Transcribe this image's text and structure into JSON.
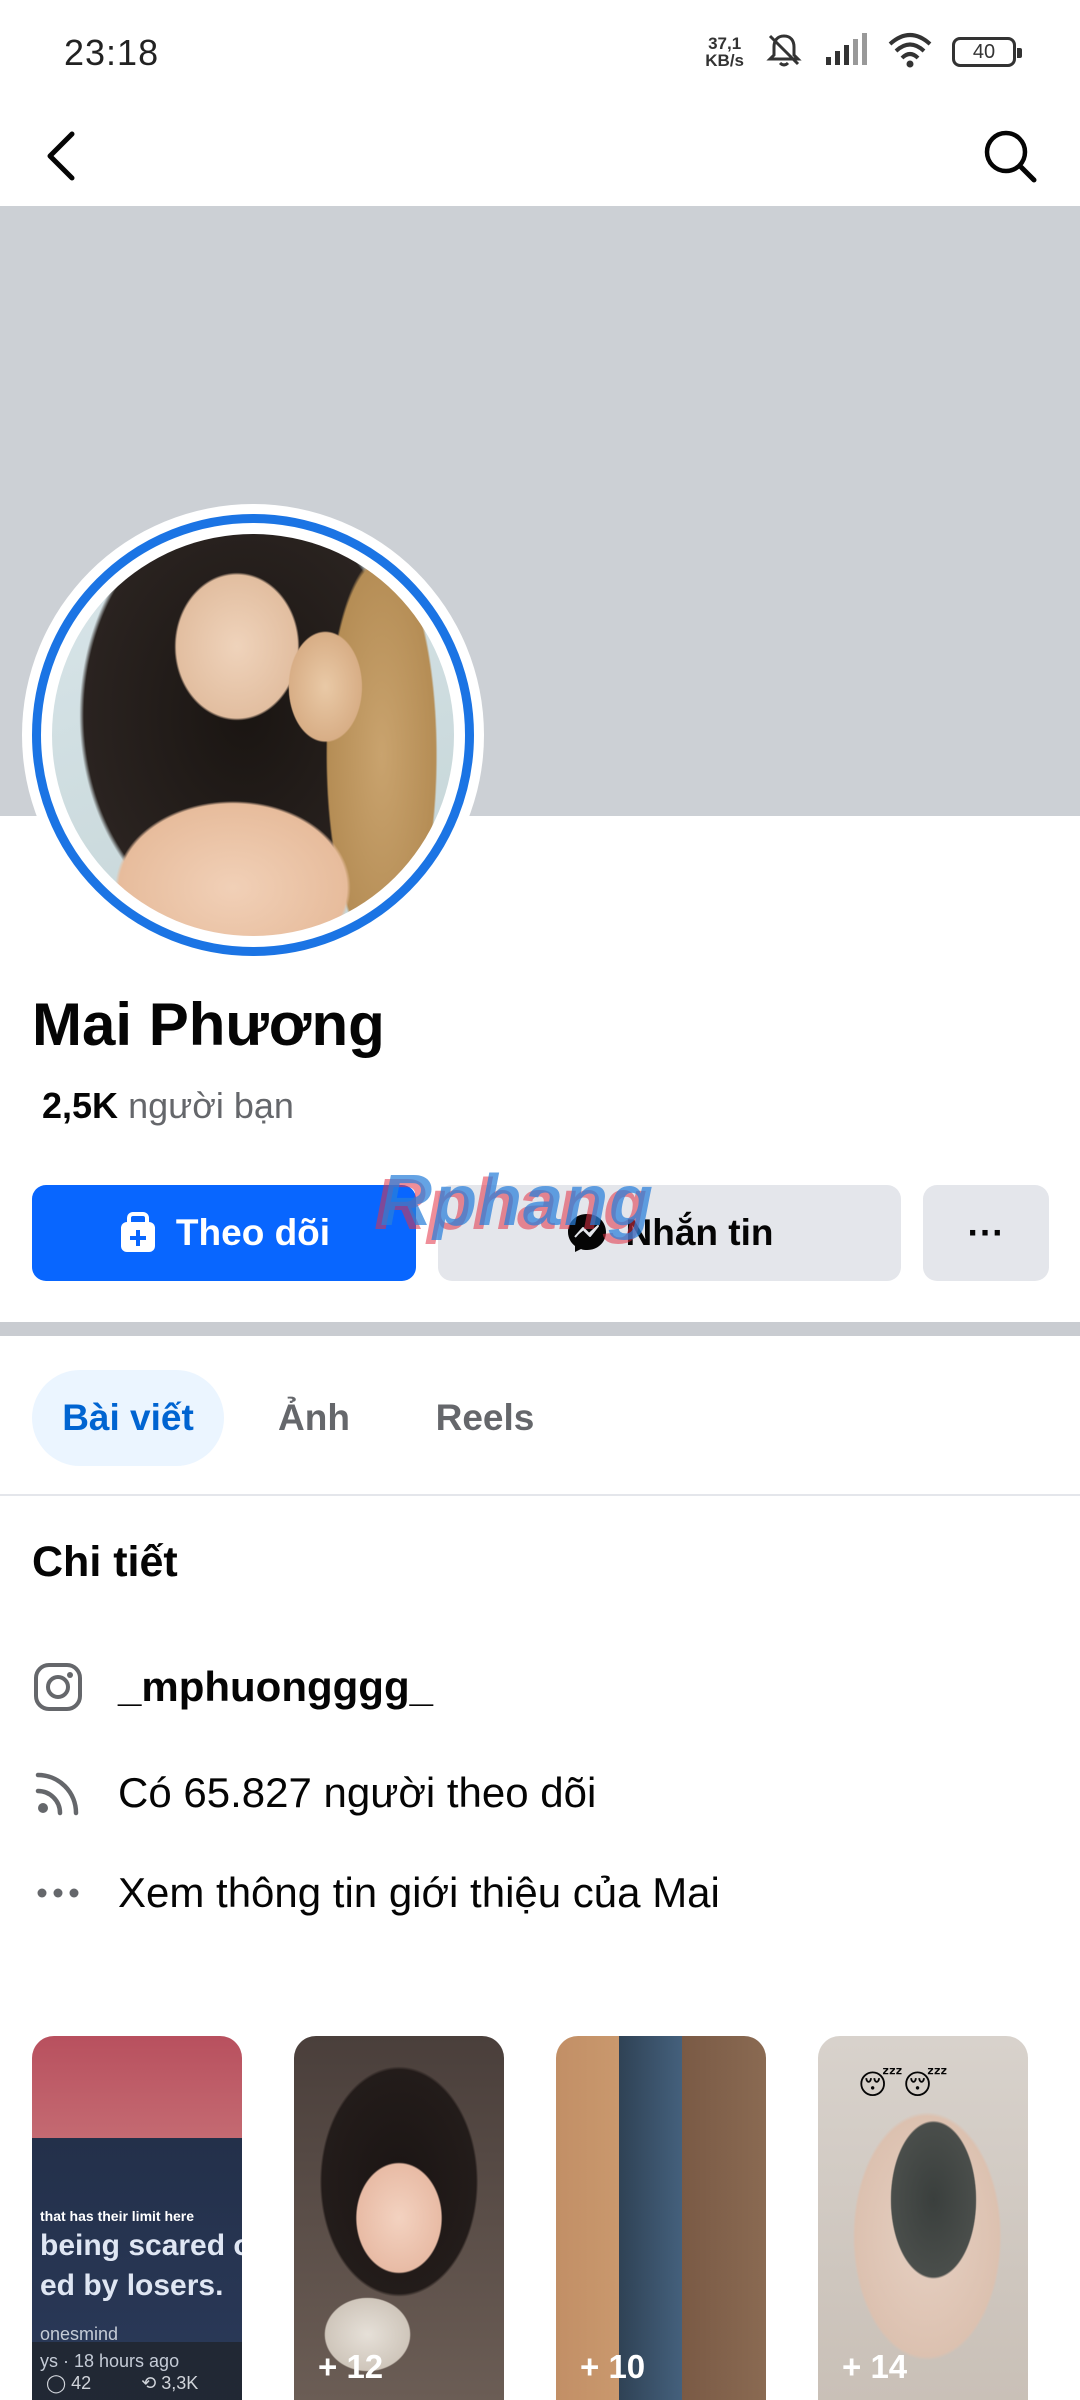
{
  "status_bar": {
    "time": "23:18",
    "net_speed_value": "37,1",
    "net_speed_unit": "KB/s",
    "battery": "40"
  },
  "nav": {
    "back_icon": "chevron-left-icon",
    "search_icon": "search-icon"
  },
  "profile": {
    "name": "Mai Phương",
    "friends_count": "2,5K",
    "friends_label": "người bạn"
  },
  "actions": {
    "follow_label": "Theo dõi",
    "message_label": "Nhắn tin",
    "more_label": "···"
  },
  "watermark": "Rphang",
  "tabs": [
    {
      "label": "Bài viết",
      "active": true
    },
    {
      "label": "Ảnh",
      "active": false
    },
    {
      "label": "Reels",
      "active": false
    }
  ],
  "details": {
    "title": "Chi tiết",
    "instagram": "_mphuongggg_",
    "followers": "Có 65.827 người theo dõi",
    "about": "Xem thông tin giới thiệu của Mai"
  },
  "stories": [
    {
      "count": "",
      "text_line1": "that has their limit here",
      "text_line2": "being scared of l",
      "text_line3": "ed by losers.",
      "meta": "onesmind",
      "meta2": "ys · 18 hours ago",
      "comments": "42",
      "shares": "3,3K"
    },
    {
      "count": "+ 12"
    },
    {
      "count": "+ 10"
    },
    {
      "count": "+ 14",
      "emoji": "😴😴"
    }
  ],
  "colors": {
    "accent": "#0866ff",
    "tab_active_bg": "#ebf5ff",
    "tab_active_text": "#0064d1",
    "secondary_button": "#e4e6eb",
    "cover": "#ccd0d5"
  }
}
